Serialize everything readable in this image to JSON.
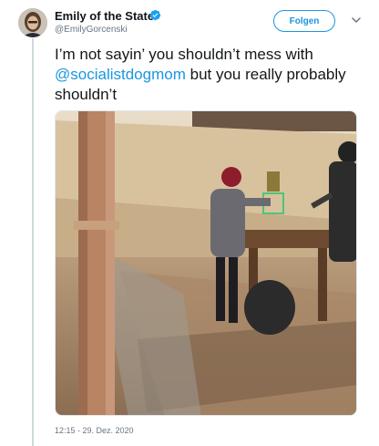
{
  "author": {
    "display_name": "Emily of the State",
    "handle": "@EmilyGorcenski"
  },
  "follow_label": "Folgen",
  "tweet": {
    "text_before": "I’m not sayin’ you shouldn’t mess with",
    "mention": "@socialistdogmom",
    "text_after": "but you really probably shouldn’t"
  },
  "timestamp": "12:15 - 29. Dez. 2020",
  "colors": {
    "accent": "#1b95e0",
    "text": "#14171a",
    "muted": "#687684"
  },
  "icons": {
    "verified": "verified-badge-icon",
    "more": "chevron-down-icon"
  },
  "media": {
    "description_icon": "photo-shooting-range"
  }
}
